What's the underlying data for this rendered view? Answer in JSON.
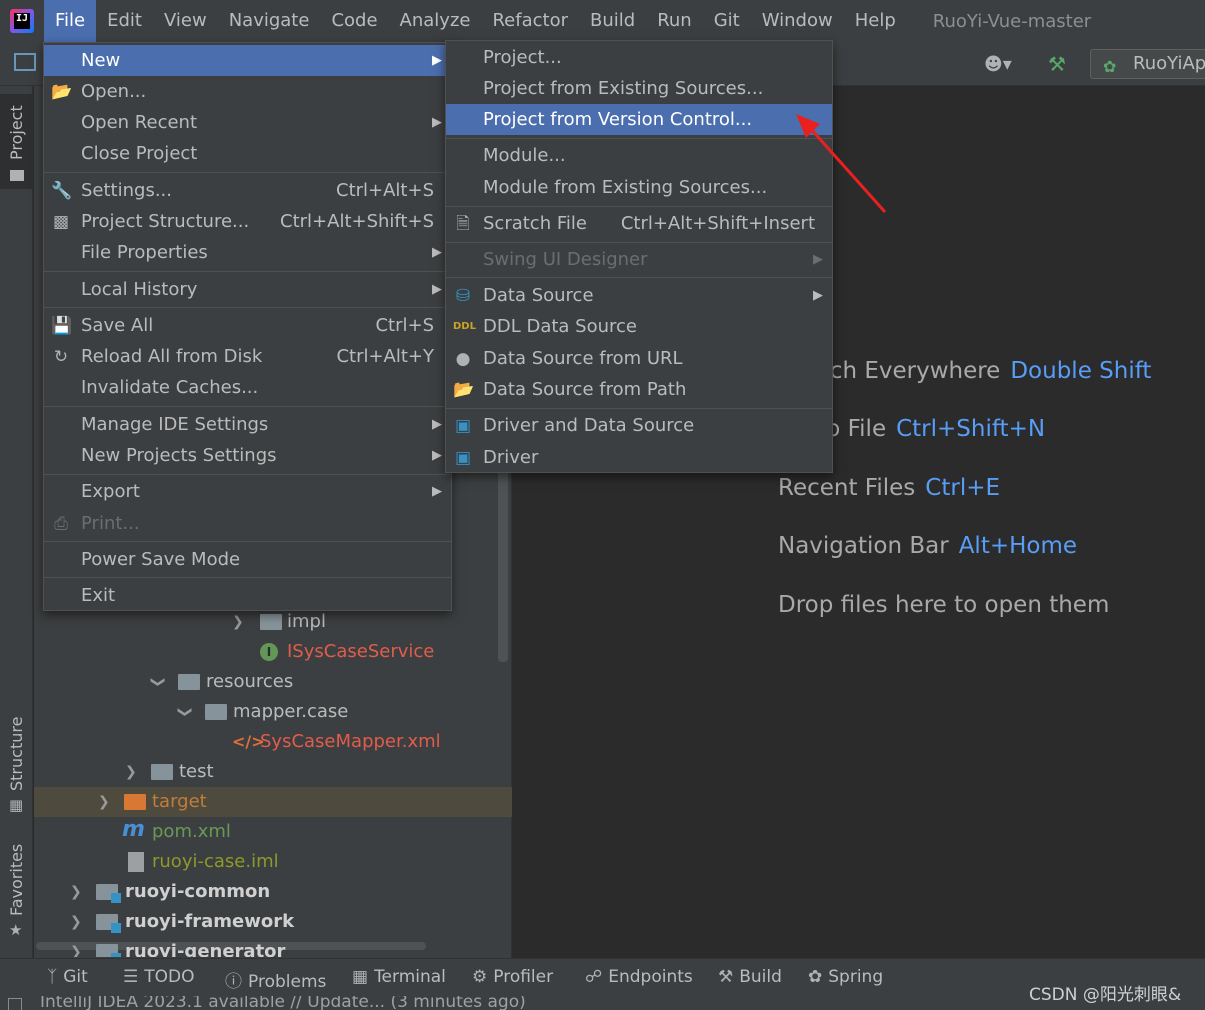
{
  "menubar": {
    "logo_text": "IJ",
    "items": [
      "File",
      "Edit",
      "View",
      "Navigate",
      "Code",
      "Analyze",
      "Refactor",
      "Build",
      "Run",
      "Git",
      "Window",
      "Help"
    ],
    "window_title": "RuoYi-Vue-master"
  },
  "toolbar": {
    "run_config": "RuoYiApplication"
  },
  "side_tabs": {
    "project": "Project",
    "structure": "Structure",
    "favorites": "Favorites"
  },
  "tree": {
    "rows": [
      {
        "name": "impl"
      },
      {
        "name": "ISysCaseService"
      },
      {
        "name": "resources"
      },
      {
        "name": "mapper.case"
      },
      {
        "name": "SysCaseMapper.xml"
      },
      {
        "name": "test"
      },
      {
        "name": "target"
      },
      {
        "name": "pom.xml"
      },
      {
        "name": "ruoyi-case.iml"
      },
      {
        "name": "ruoyi-common"
      },
      {
        "name": "ruoyi-framework"
      },
      {
        "name": "ruoyi-generator"
      }
    ]
  },
  "editor": {
    "hints": [
      {
        "text": "Search Everywhere",
        "key": "Double Shift"
      },
      {
        "text": "Go to File",
        "key": "Ctrl+Shift+N"
      },
      {
        "text": "Recent Files",
        "key": "Ctrl+E"
      },
      {
        "text": "Navigation Bar",
        "key": "Alt+Home"
      },
      {
        "text": "Drop files here to open them",
        "key": ""
      }
    ]
  },
  "file_menu": {
    "items": [
      {
        "label": "New",
        "shortcut": "",
        "submenu": true
      },
      {
        "label": "Open...",
        "shortcut": ""
      },
      {
        "label": "Open Recent",
        "shortcut": "",
        "submenu": true
      },
      {
        "label": "Close Project",
        "shortcut": ""
      },
      {
        "label": "Settings...",
        "shortcut": "Ctrl+Alt+S"
      },
      {
        "label": "Project Structure...",
        "shortcut": "Ctrl+Alt+Shift+S"
      },
      {
        "label": "File Properties",
        "shortcut": "",
        "submenu": true
      },
      {
        "label": "Local History",
        "shortcut": "",
        "submenu": true
      },
      {
        "label": "Save All",
        "shortcut": "Ctrl+S"
      },
      {
        "label": "Reload All from Disk",
        "shortcut": "Ctrl+Alt+Y"
      },
      {
        "label": "Invalidate Caches...",
        "shortcut": ""
      },
      {
        "label": "Manage IDE Settings",
        "shortcut": "",
        "submenu": true
      },
      {
        "label": "New Projects Settings",
        "shortcut": "",
        "submenu": true
      },
      {
        "label": "Export",
        "shortcut": "",
        "submenu": true
      },
      {
        "label": "Print...",
        "shortcut": "",
        "disabled": true
      },
      {
        "label": "Power Save Mode",
        "shortcut": ""
      },
      {
        "label": "Exit",
        "shortcut": ""
      }
    ]
  },
  "new_submenu": {
    "items": [
      {
        "label": "Project..."
      },
      {
        "label": "Project from Existing Sources..."
      },
      {
        "label": "Project from Version Control...",
        "highlighted": true
      },
      {
        "label": "Module..."
      },
      {
        "label": "Module from Existing Sources..."
      },
      {
        "label": "Scratch File",
        "shortcut": "Ctrl+Alt+Shift+Insert"
      },
      {
        "label": "Swing UI Designer",
        "disabled": true,
        "submenu": true
      },
      {
        "label": "Data Source",
        "submenu": true
      },
      {
        "label": "DDL Data Source"
      },
      {
        "label": "Data Source from URL"
      },
      {
        "label": "Data Source from Path"
      },
      {
        "label": "Driver and Data Source"
      },
      {
        "label": "Driver"
      }
    ]
  },
  "bottom_bar": {
    "tabs": [
      "Git",
      "TODO",
      "Problems",
      "Terminal",
      "Profiler",
      "Endpoints",
      "Build",
      "Spring"
    ]
  },
  "status": {
    "text": "IntelliJ IDEA 2023.1 available // Update... (3 minutes ago)"
  },
  "watermark": "CSDN @阳光刺眼&",
  "colors": {
    "accent": "#4b6eaf",
    "annotation_arrow": "#e8211f"
  }
}
